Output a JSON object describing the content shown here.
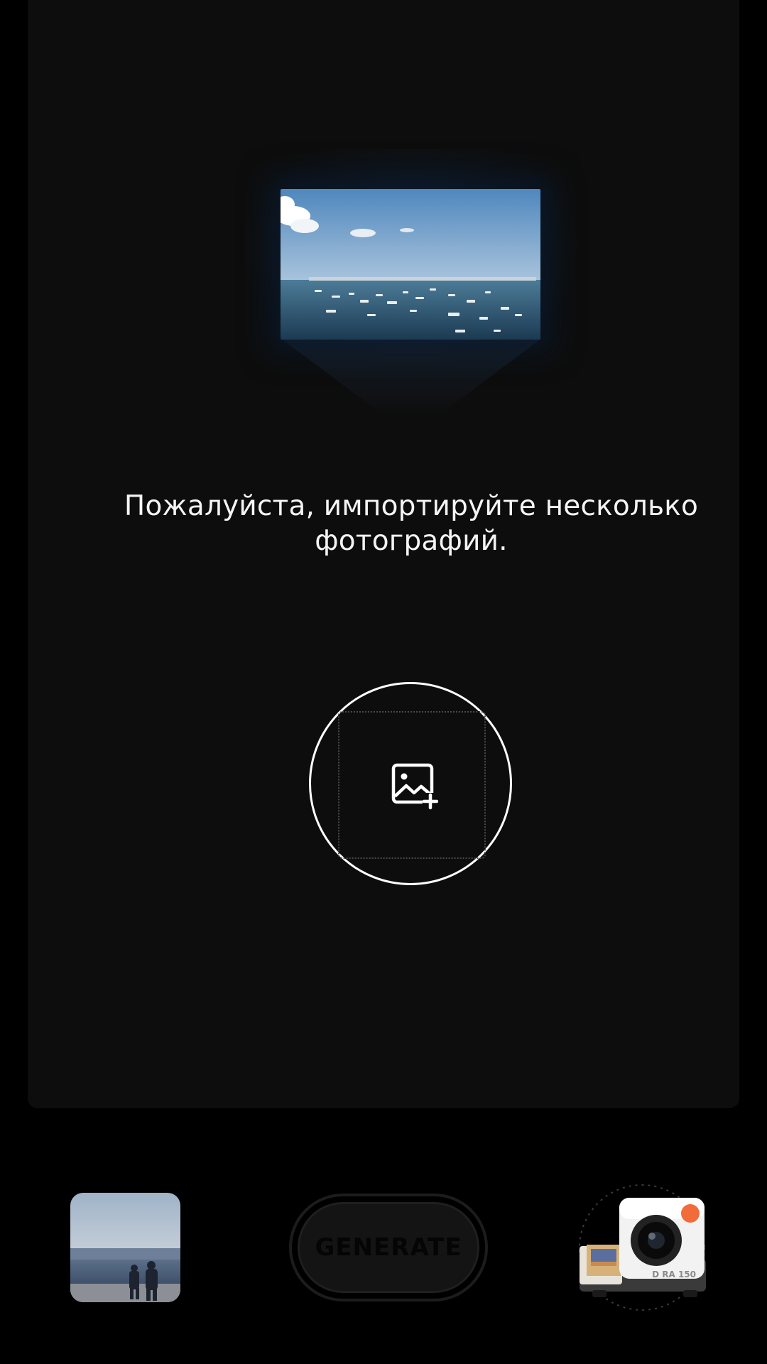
{
  "message": {
    "text": "Пожалуйста, импортируйте несколько фотографий."
  },
  "import_button": {
    "icon": "image-add-icon"
  },
  "generate_button": {
    "label": "GENERATE"
  },
  "camera_selector": {
    "model_label": "D RA 150",
    "icon": "instant-camera-icon"
  },
  "thumbnail": {
    "icon": "recent-photo-thumbnail"
  },
  "colors": {
    "background": "#000000",
    "panel": "#0d0d0d",
    "text": "#f4f4f4",
    "camera_accent": "#f26b3a"
  }
}
